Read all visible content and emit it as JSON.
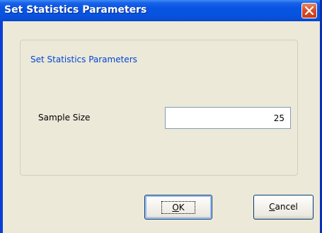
{
  "window": {
    "title": "Set Statistics Parameters",
    "close_icon": "close-x-icon"
  },
  "group": {
    "legend": "Set Statistics Parameters"
  },
  "sample_size": {
    "label": "Sample Size",
    "value": "25"
  },
  "buttons": {
    "ok": {
      "mnemonic": "O",
      "rest": "K"
    },
    "cancel": {
      "mnemonic": "C",
      "rest": "ancel"
    }
  },
  "colors": {
    "titlebar": "#0654e0",
    "client": "#ece9d8",
    "legend": "#0046d5",
    "close_button": "#d8502c"
  }
}
